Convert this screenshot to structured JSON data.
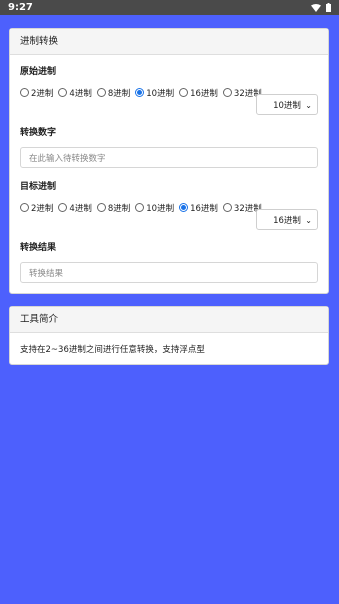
{
  "status_bar": {
    "time": "9:27"
  },
  "converter": {
    "title": "进制转换",
    "source_label": "原始进制",
    "source_options": [
      "2进制",
      "4进制",
      "8进制",
      "10进制",
      "16进制",
      "32进制"
    ],
    "source_selected": "10进制",
    "source_dropdown": "10进制",
    "input_label": "转换数字",
    "input_placeholder": "在此输入待转换数字",
    "target_label": "目标进制",
    "target_options": [
      "2进制",
      "4进制",
      "8进制",
      "10进制",
      "16进制",
      "32进制"
    ],
    "target_selected": "16进制",
    "target_dropdown": "16进制",
    "result_label": "转换结果",
    "result_placeholder": "转换结果"
  },
  "intro": {
    "title": "工具简介",
    "text": "支持在2~36进制之间进行任意转换，支持浮点型"
  },
  "colors": {
    "background": "#4d60fd",
    "accent": "#1a73e8",
    "statusbar": "#4a4a4a"
  }
}
